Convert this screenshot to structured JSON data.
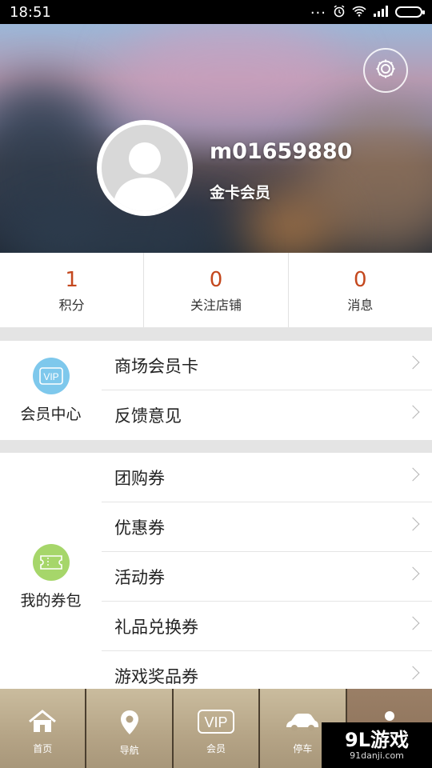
{
  "status_bar": {
    "time": "18:51",
    "more_dots": "...",
    "icons": [
      "alarm-icon",
      "wifi-icon",
      "signal-icon",
      "battery-icon"
    ]
  },
  "profile": {
    "username": "m01659880",
    "level": "金卡会员",
    "settings_icon": "gear-icon"
  },
  "stats": [
    {
      "value": "1",
      "label": "积分"
    },
    {
      "value": "0",
      "label": "关注店铺"
    },
    {
      "value": "0",
      "label": "消息"
    }
  ],
  "member_section": {
    "title": "会员中心",
    "icon": "vip-icon",
    "icon_text": "VIP",
    "items": [
      {
        "label": "商场会员卡"
      },
      {
        "label": "反馈意见"
      }
    ]
  },
  "coupon_section": {
    "title": "我的券包",
    "icon": "ticket-icon",
    "items": [
      {
        "label": "团购券"
      },
      {
        "label": "优惠券"
      },
      {
        "label": "活动券"
      },
      {
        "label": "礼品兑换券"
      },
      {
        "label": "游戏奖品券"
      }
    ]
  },
  "bottom_nav": {
    "tabs": [
      {
        "label": "首页",
        "icon": "home-icon"
      },
      {
        "label": "导航",
        "icon": "location-pin-icon"
      },
      {
        "label": "会员",
        "icon": "vip-icon",
        "icon_text": "VIP"
      },
      {
        "label": "停车",
        "icon": "car-icon"
      },
      {
        "label": "",
        "icon": "person-icon"
      }
    ]
  },
  "watermark": {
    "main": "9L游戏",
    "sub": "91danji.com"
  },
  "colors": {
    "stat_number": "#c4481e",
    "vip_icon": "#7ec8ec",
    "ticket_icon": "#a6d66a",
    "divider": "#e4e4e4"
  }
}
